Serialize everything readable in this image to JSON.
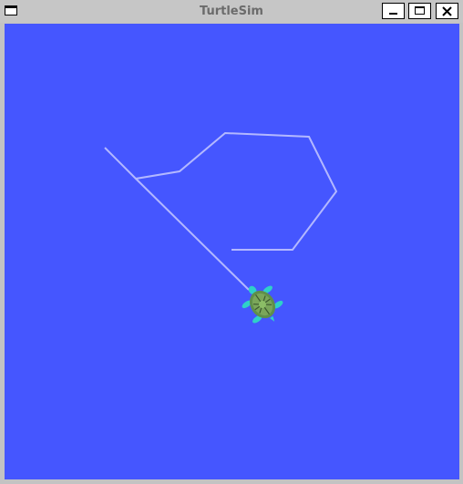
{
  "window": {
    "title": "TurtleSim",
    "menu_icon": "window-menu-icon",
    "minimize_icon": "minimize-icon",
    "maximize_icon": "maximize-icon",
    "close_icon": "close-icon"
  },
  "canvas": {
    "background_color": "#4556ff",
    "pen_color": "#b3b8ff",
    "turtle_icon": "turtle-icon"
  }
}
